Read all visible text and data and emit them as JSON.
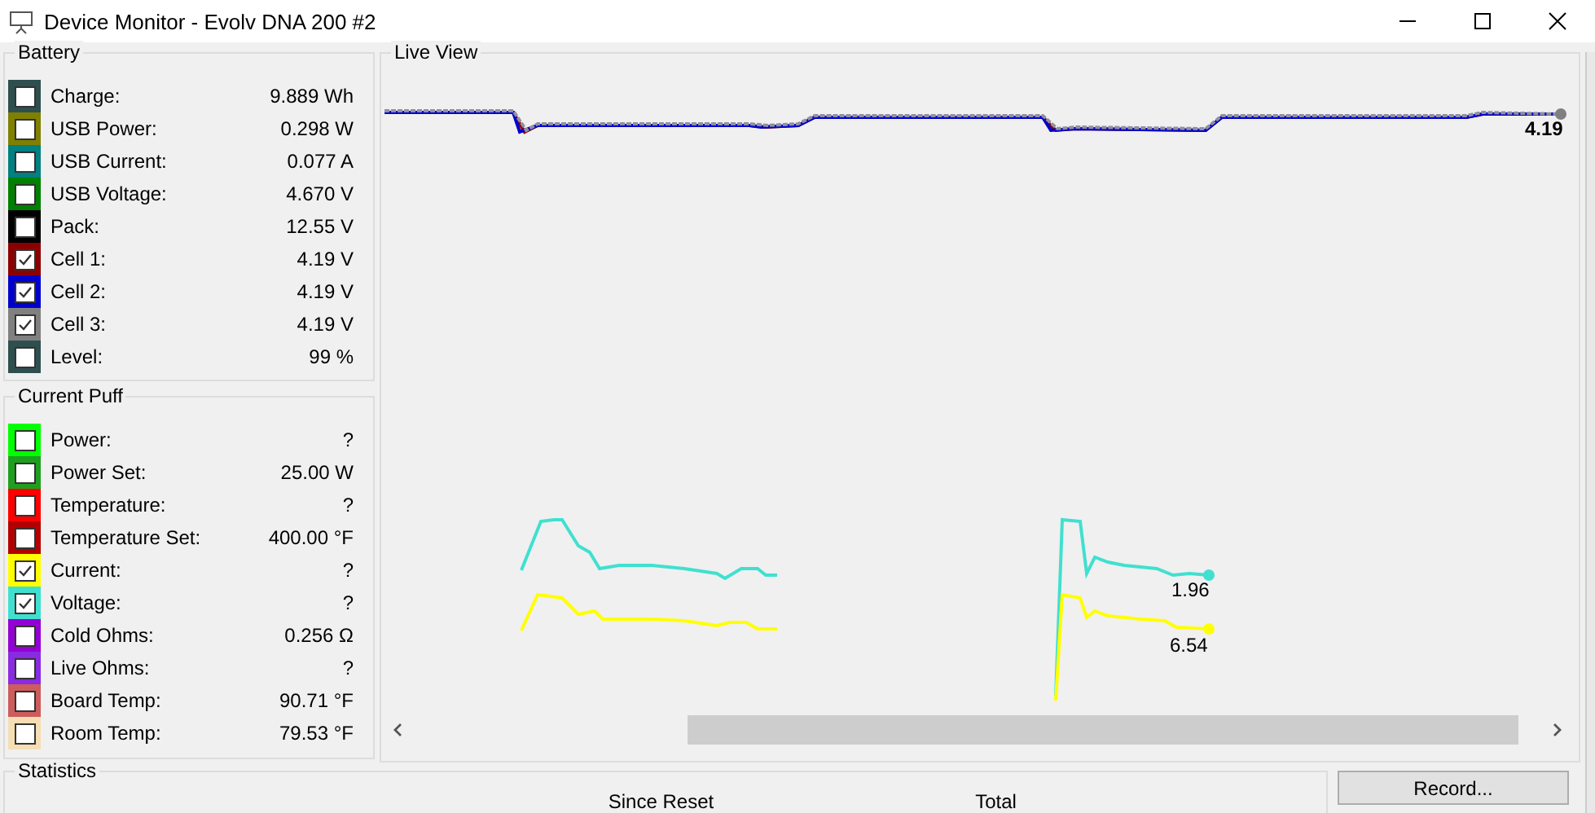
{
  "window": {
    "title": "Device Monitor - Evolv DNA 200 #2"
  },
  "battery": {
    "title": "Battery",
    "items": [
      {
        "label": "Charge:",
        "value": "9.889 Wh",
        "color": "#2f4f4f",
        "checked": false
      },
      {
        "label": "USB Power:",
        "value": "0.298 W",
        "color": "#808000",
        "checked": false
      },
      {
        "label": "USB Current:",
        "value": "0.077 A",
        "color": "#008080",
        "checked": false
      },
      {
        "label": "USB Voltage:",
        "value": "4.670 V",
        "color": "#008000",
        "checked": false
      },
      {
        "label": "Pack:",
        "value": "12.55 V",
        "color": "#000000",
        "checked": false
      },
      {
        "label": "Cell 1:",
        "value": "4.19 V",
        "color": "#8b0000",
        "checked": true
      },
      {
        "label": "Cell 2:",
        "value": "4.19 V",
        "color": "#0000cd",
        "checked": true
      },
      {
        "label": "Cell 3:",
        "value": "4.19 V",
        "color": "#808080",
        "checked": true
      },
      {
        "label": "Level:",
        "value": "99 %",
        "color": "#2f4f4f",
        "checked": false
      }
    ]
  },
  "current_puff": {
    "title": "Current Puff",
    "items": [
      {
        "label": "Power:",
        "value": "?",
        "color": "#00ff00",
        "checked": false
      },
      {
        "label": "Power Set:",
        "value": "25.00 W",
        "color": "#1ea01e",
        "checked": false
      },
      {
        "label": "Temperature:",
        "value": "?",
        "color": "#ff0000",
        "checked": false
      },
      {
        "label": "Temperature Set:",
        "value": "400.00 °F",
        "color": "#b40000",
        "checked": false
      },
      {
        "label": "Current:",
        "value": "?",
        "color": "#ffff00",
        "checked": true
      },
      {
        "label": "Voltage:",
        "value": "?",
        "color": "#40e0d0",
        "checked": true
      },
      {
        "label": "Cold Ohms:",
        "value": "0.256 Ω",
        "color": "#9400d3",
        "checked": false
      },
      {
        "label": "Live Ohms:",
        "value": "?",
        "color": "#8a2be2",
        "checked": false
      },
      {
        "label": "Board Temp:",
        "value": "90.71 °F",
        "color": "#cd5c5c",
        "checked": false
      },
      {
        "label": "Room Temp:",
        "value": "79.53 °F",
        "color": "#f5deb3",
        "checked": false
      }
    ]
  },
  "live_view": {
    "title": "Live View",
    "value_labels": [
      "4.19",
      "1.96",
      "6.54"
    ]
  },
  "statistics": {
    "title": "Statistics",
    "columns": [
      "Since Reset",
      "Total"
    ]
  },
  "buttons": [
    "Record..."
  ]
}
